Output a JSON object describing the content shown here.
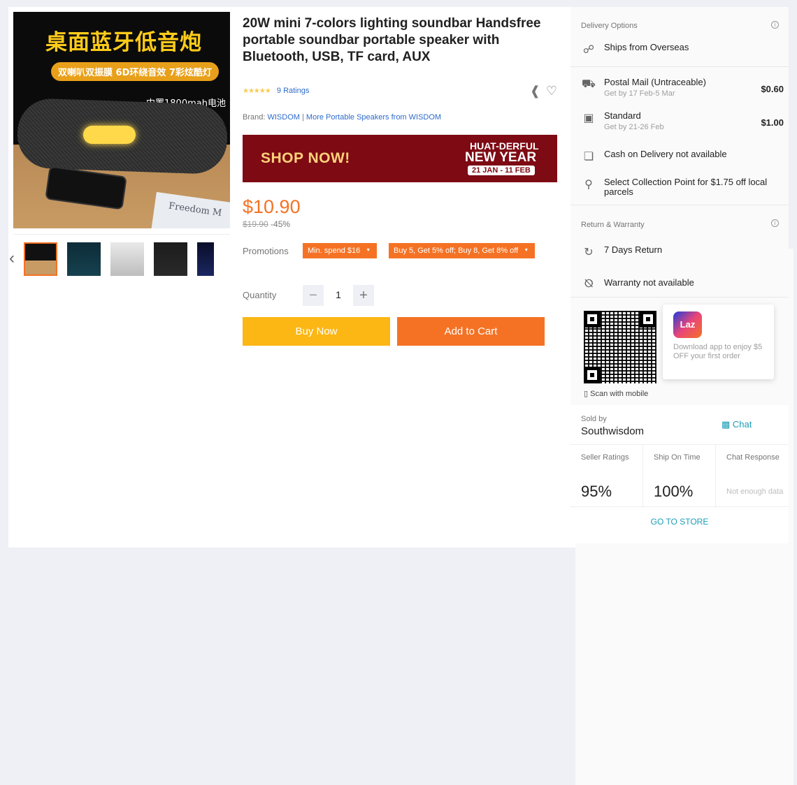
{
  "product": {
    "title": "20W mini 7-colors lighting soundbar Handsfree portable soundbar portable speaker with Bluetooth, USB, TF card, AUX",
    "ratings_count": "9 Ratings",
    "brand_label": "Brand:",
    "brand": "WISDOM",
    "more_from": "More Portable Speakers from WISDOM",
    "price": "$10.90",
    "original_price": "$19.90",
    "discount": "-45%",
    "image_text": {
      "headline": "桌面蓝牙低音炮",
      "sub": "双喇叭双振膜 6D环绕音效 7彩炫酷灯",
      "battery": "内置1800mah电池",
      "book": "Freedom M"
    }
  },
  "banner": {
    "cta": "SHOP NOW!",
    "line1": "HUAT-DERFUL",
    "line2": "NEW YEAR",
    "dates": "21 JAN - 11 FEB"
  },
  "promotions": {
    "label": "Promotions",
    "tags": [
      "Min. spend $16",
      "Buy 5, Get 5% off; Buy 8, Get 8% off"
    ]
  },
  "quantity": {
    "label": "Quantity",
    "value": "1"
  },
  "actions": {
    "buy_now": "Buy Now",
    "add_to_cart": "Add to Cart"
  },
  "delivery": {
    "title": "Delivery Options",
    "ships_from": "Ships from Overseas",
    "options": [
      {
        "name": "Postal Mail (Untraceable)",
        "eta": "Get by 17 Feb-5 Mar",
        "price": "$0.60"
      },
      {
        "name": "Standard",
        "eta": "Get by 21-26 Feb",
        "price": "$1.00"
      }
    ],
    "cod": "Cash on Delivery not available",
    "collection": "Select Collection Point for $1.75 off local parcels"
  },
  "return_warranty": {
    "title": "Return & Warranty",
    "return": "7 Days Return",
    "warranty": "Warranty not available"
  },
  "app_promo": {
    "scan": "Scan with mobile",
    "logo": "Laz",
    "text": "Download app to enjoy $5 OFF your first order"
  },
  "seller": {
    "sold_by": "Sold by",
    "name": "Southwisdom",
    "chat": "Chat",
    "stats": [
      {
        "label": "Seller Ratings",
        "value": "95%"
      },
      {
        "label": "Ship On Time",
        "value": "100%"
      },
      {
        "label": "Chat Response",
        "value": "Not enough data"
      }
    ],
    "go_to_store": "GO TO STORE"
  },
  "colors": {
    "accent": "#f57224",
    "buy": "#fcb714",
    "link": "#2e6bcb",
    "teal": "#1a9cb7"
  },
  "icons": [
    "share-icon",
    "heart-icon",
    "info-icon",
    "globe-icon",
    "truck-icon",
    "box-icon",
    "cash-icon",
    "location-pin-icon",
    "return-icon",
    "shield-icon",
    "phone-icon",
    "chat-icon",
    "chevron-left-icon",
    "chevron-right-icon"
  ]
}
